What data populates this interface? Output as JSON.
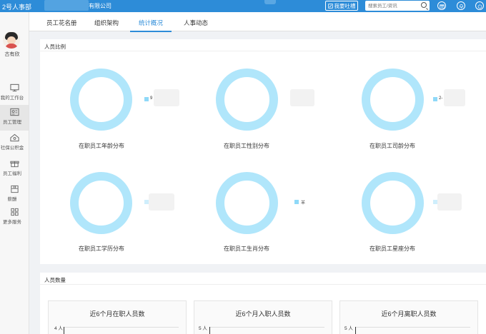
{
  "topbar": {
    "brand": "2号人事部",
    "company": "有限公司",
    "feedback": "我要吐槽",
    "search_placeholder": "搜索员工/资讯",
    "icons": [
      "gift-icon",
      "bell-icon",
      "power-icon"
    ]
  },
  "user": {
    "name": "古有欣"
  },
  "sidebar": {
    "items": [
      {
        "label": "我的工作台",
        "icon": "monitor-icon"
      },
      {
        "label": "员工管理",
        "icon": "employee-card-icon",
        "active": true
      },
      {
        "label": "社保公积金",
        "icon": "house-icon"
      },
      {
        "label": "员工福利",
        "icon": "gift-icon"
      },
      {
        "label": "薪酬",
        "icon": "wallet-icon"
      },
      {
        "label": "更多服务",
        "icon": "grid-icon"
      }
    ]
  },
  "tabs": [
    {
      "label": "员工花名册"
    },
    {
      "label": "组织架构"
    },
    {
      "label": "统计概况",
      "active": true
    },
    {
      "label": "人事动态"
    }
  ],
  "ratio_panel": {
    "title": "人员比例",
    "charts": [
      {
        "title": "在职员工年龄分布",
        "legend": "9"
      },
      {
        "title": "在职员工性别分布",
        "legend": ""
      },
      {
        "title": "在职员工司龄分布",
        "legend": "2-"
      },
      {
        "title": "在职员工学历分布",
        "legend": ""
      },
      {
        "title": "在职员工生肖分布",
        "legend": "羊"
      },
      {
        "title": "在职员工星座分布",
        "legend": ""
      }
    ]
  },
  "count_panel": {
    "title": "人员数量",
    "cards": [
      {
        "title": "近6个月在职人员数",
        "y_top": "4 人"
      },
      {
        "title": "近6个月入职人员数",
        "y_top": "5 人"
      },
      {
        "title": "近6个月离职人员数",
        "y_top": "5 人"
      }
    ]
  },
  "colors": {
    "accent": "#2d8cd8",
    "donut": "#b0e6fb"
  }
}
